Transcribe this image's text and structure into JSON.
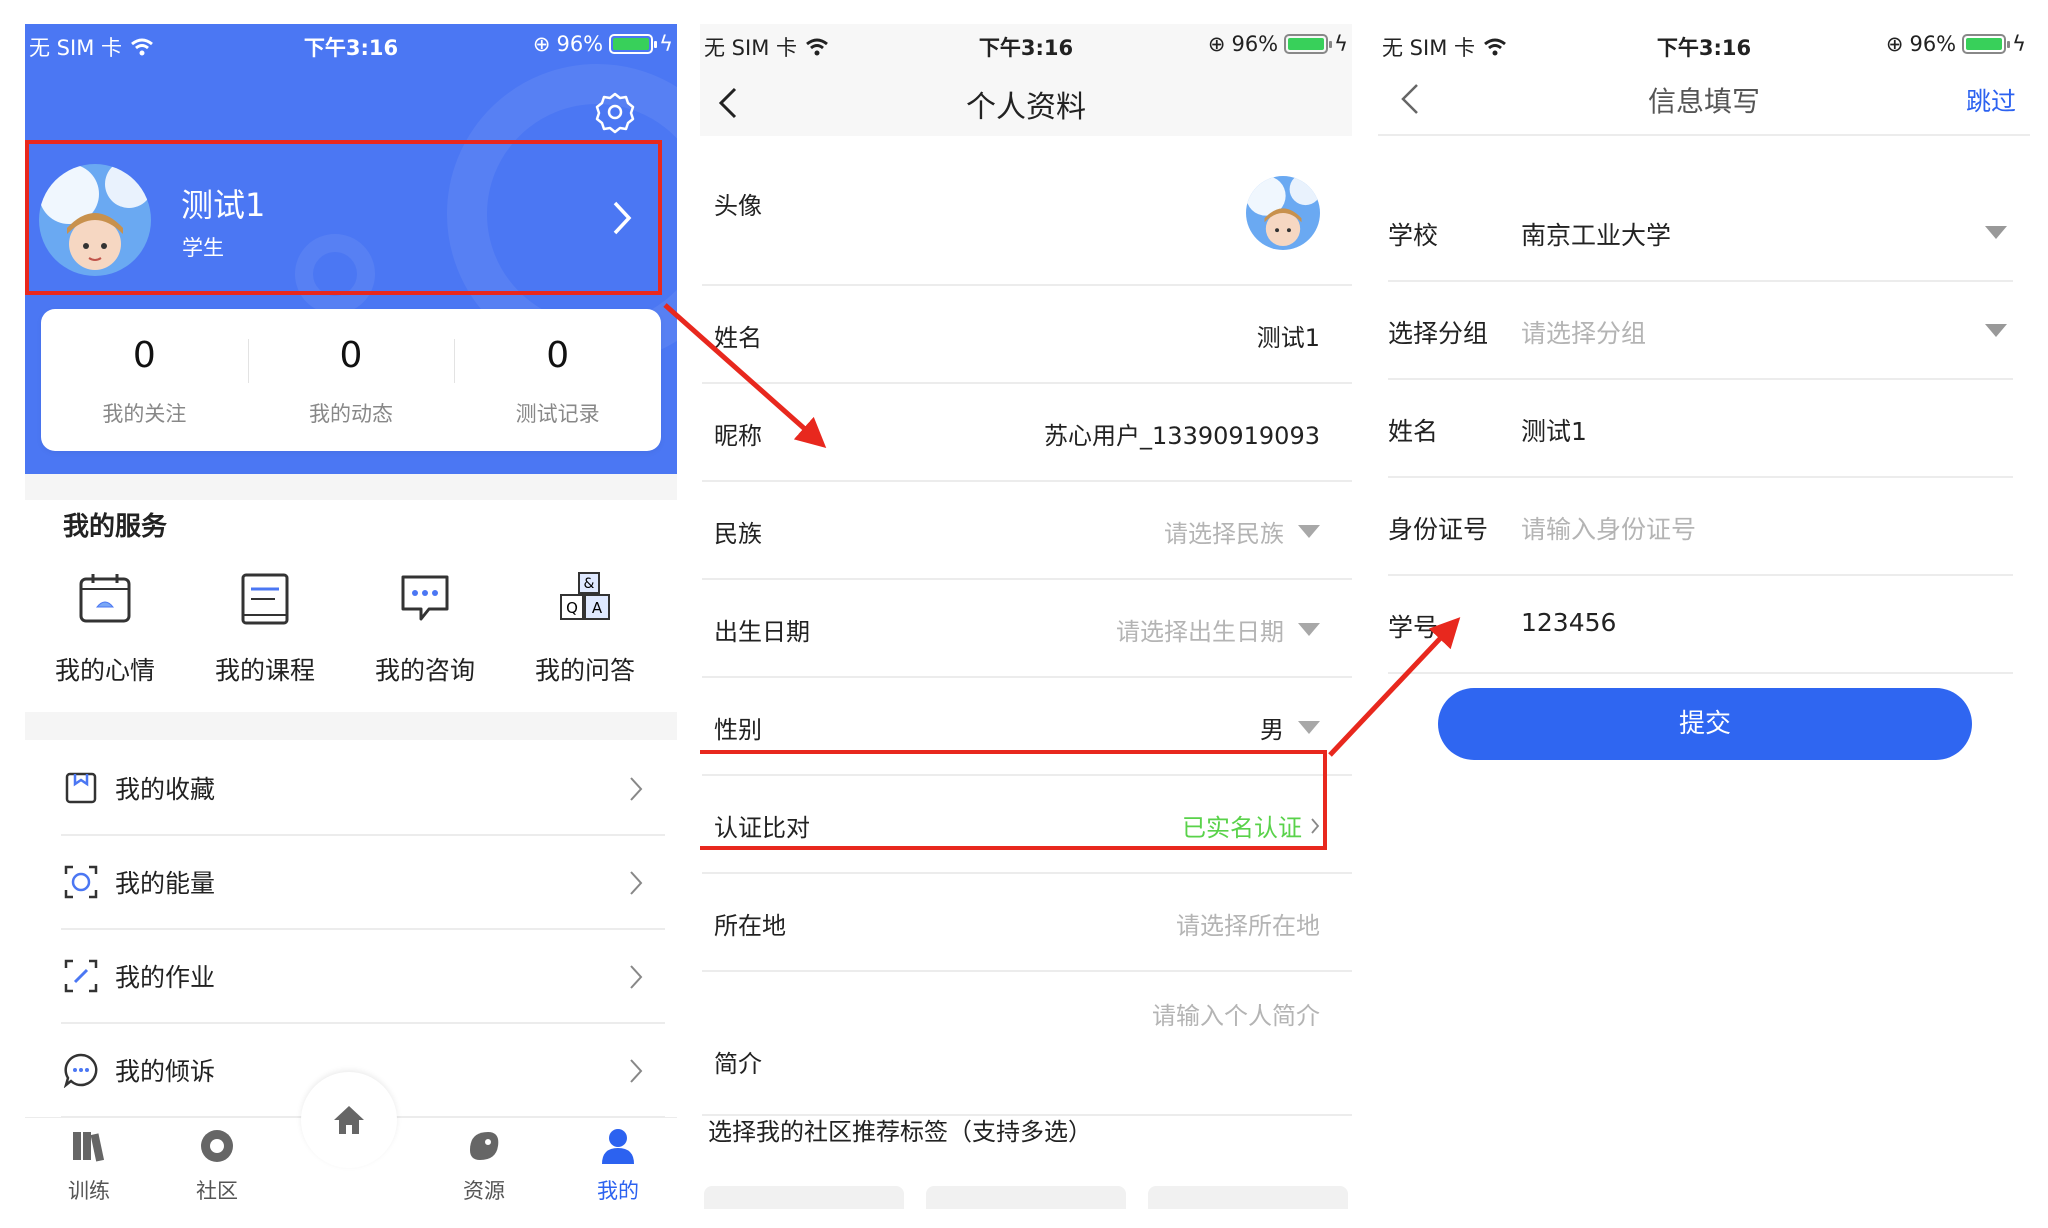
{
  "status_bar": {
    "carrier": "无 SIM 卡",
    "time": "下午3:16",
    "battery": "96%"
  },
  "screen1": {
    "profile": {
      "name": "测试1",
      "role": "学生"
    },
    "stats": [
      {
        "value": "0",
        "label": "我的关注"
      },
      {
        "value": "0",
        "label": "我的动态"
      },
      {
        "value": "0",
        "label": "测试记录"
      }
    ],
    "services_title": "我的服务",
    "services": [
      "我的心情",
      "我的课程",
      "我的咨询",
      "我的问答"
    ],
    "menu": [
      "我的收藏",
      "我的能量",
      "我的作业",
      "我的倾诉"
    ],
    "tabs": [
      "训练",
      "社区",
      "资源",
      "我的"
    ],
    "colors": {
      "primary": "#4b77f3",
      "highlight": "#e8281e",
      "tab_active": "#2c62f0"
    }
  },
  "screen2": {
    "title": "个人资料",
    "rows": {
      "avatar": "头像",
      "name_label": "姓名",
      "name_value": "测试1",
      "nick_label": "昵称",
      "nick_value": "苏心用户_13390919093",
      "ethnic_label": "民族",
      "ethnic_ph": "请选择民族",
      "birth_label": "出生日期",
      "birth_ph": "请选择出生日期",
      "gender_label": "性别",
      "gender_value": "男",
      "auth_label": "认证比对",
      "auth_value": "已实名认证",
      "location_label": "所在地",
      "location_ph": "请选择所在地",
      "bio_label": "简介",
      "bio_ph": "请输入个人简介"
    },
    "tag_title": "选择我的社区推荐标签（支持多选）",
    "colors": {
      "verified": "#59d24a"
    }
  },
  "screen3": {
    "title": "信息填写",
    "skip": "跳过",
    "fields": {
      "school_label": "学校",
      "school_value": "南京工业大学",
      "group_label": "选择分组",
      "group_ph": "请选择分组",
      "name_label": "姓名",
      "name_value": "测试1",
      "id_label": "身份证号",
      "id_ph": "请输入身份证号",
      "sno_label": "学号",
      "sno_value": "123456"
    },
    "submit": "提交",
    "colors": {
      "button": "#2f66f1"
    }
  }
}
